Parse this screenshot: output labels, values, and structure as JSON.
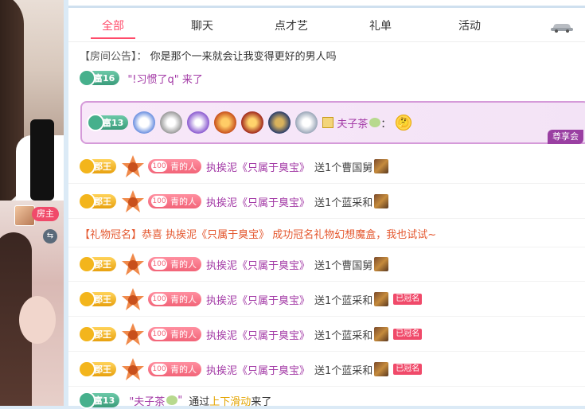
{
  "tabs": [
    {
      "label": "全部",
      "active": true
    },
    {
      "label": "聊天",
      "active": false
    },
    {
      "label": "点才艺",
      "active": false
    },
    {
      "label": "礼单",
      "active": false
    },
    {
      "label": "活动",
      "active": false
    }
  ],
  "left": {
    "host_label": "房主"
  },
  "notice": {
    "tag": "【房间公告】：",
    "text": "你是那个一来就会让我变得更好的男人吗"
  },
  "partial_row": {
    "level": "富16",
    "text": "\"!习惯了q\" 来了"
  },
  "vip": {
    "level": "富13",
    "user": "夫子茶",
    "colon": "：",
    "tag": "尊享会"
  },
  "gift_rows": [
    {
      "rank": "郡王",
      "fan_num": "100",
      "fan_label": "青的人",
      "user": "执挨泥《只属于臭宝》",
      "action": "送1个曹国舅",
      "crowned": ""
    },
    {
      "rank": "郡王",
      "fan_num": "100",
      "fan_label": "青的人",
      "user": "执挨泥《只属于臭宝》",
      "action": "送1个蓝采和",
      "crowned": ""
    },
    {
      "rank": "郡王",
      "fan_num": "100",
      "fan_label": "青的人",
      "user": "执挨泥《只属于臭宝》",
      "action": "送1个曹国舅",
      "crowned": ""
    },
    {
      "rank": "郡王",
      "fan_num": "100",
      "fan_label": "青的人",
      "user": "执挨泥《只属于臭宝》",
      "action": "送1个蓝采和",
      "crowned": "已冠名"
    },
    {
      "rank": "郡王",
      "fan_num": "100",
      "fan_label": "青的人",
      "user": "执挨泥《只属于臭宝》",
      "action": "送1个蓝采和",
      "crowned": "已冠名"
    },
    {
      "rank": "郡王",
      "fan_num": "100",
      "fan_label": "青的人",
      "user": "执挨泥《只属于臭宝》",
      "action": "送1个蓝采和",
      "crowned": "已冠名"
    }
  ],
  "gift_crown_notice": "【礼物冠名】恭喜 执挨泥《只属于臭宝》 成功冠名礼物幻想魔盒，我也试试~",
  "bottom_row": {
    "level": "富13",
    "user": "\"夫子茶",
    "end_quote": "\"",
    "via": "通过",
    "link": "上下滑动",
    "came": "来了"
  },
  "colors": {
    "accent": "#ff4b6a",
    "username": "#a33aa6",
    "notice_orange": "#e4572e"
  }
}
